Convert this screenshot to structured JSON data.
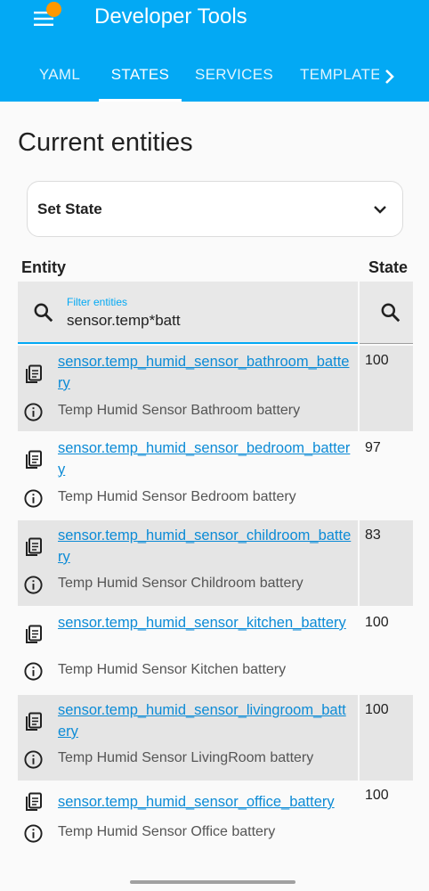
{
  "header": {
    "title": "Developer Tools",
    "tabs": [
      {
        "label": "YAML"
      },
      {
        "label": "STATES"
      },
      {
        "label": "SERVICES"
      },
      {
        "label": "TEMPLATE"
      }
    ],
    "active_tab": "STATES",
    "colors": {
      "bar": "#03a9f4",
      "badge": "#ff9800"
    }
  },
  "page": {
    "title": "Current entities",
    "set_state_label": "Set State"
  },
  "table": {
    "col_entity": "Entity",
    "col_state": "State",
    "filter_label": "Filter entities",
    "filter_value": "sensor.temp*batt",
    "rows": [
      {
        "entity_id": "sensor.temp_humid_sensor_bathroom_battery",
        "name": "Temp Humid Sensor Bathroom battery",
        "state": "100"
      },
      {
        "entity_id": "sensor.temp_humid_sensor_bedroom_battery",
        "name": "Temp Humid Sensor Bedroom battery",
        "state": "97"
      },
      {
        "entity_id": "sensor.temp_humid_sensor_childroom_battery",
        "name": "Temp Humid Sensor Childroom battery",
        "state": "83"
      },
      {
        "entity_id": "sensor.temp_humid_sensor_kitchen_battery",
        "name": "Temp Humid Sensor Kitchen battery",
        "state": "100"
      },
      {
        "entity_id": "sensor.temp_humid_sensor_livingroom_battery",
        "name": "Temp Humid Sensor LivingRoom battery",
        "state": "100"
      },
      {
        "entity_id": "sensor.temp_humid_sensor_office_battery",
        "name": "Temp Humid Sensor Office battery",
        "state": "100"
      }
    ]
  },
  "icons": {
    "menu": "menu-icon",
    "next": "chevron-right-icon",
    "dropdown": "chevron-down-icon",
    "search": "search-icon",
    "copy": "clipboard-copy-icon",
    "info": "info-icon"
  }
}
